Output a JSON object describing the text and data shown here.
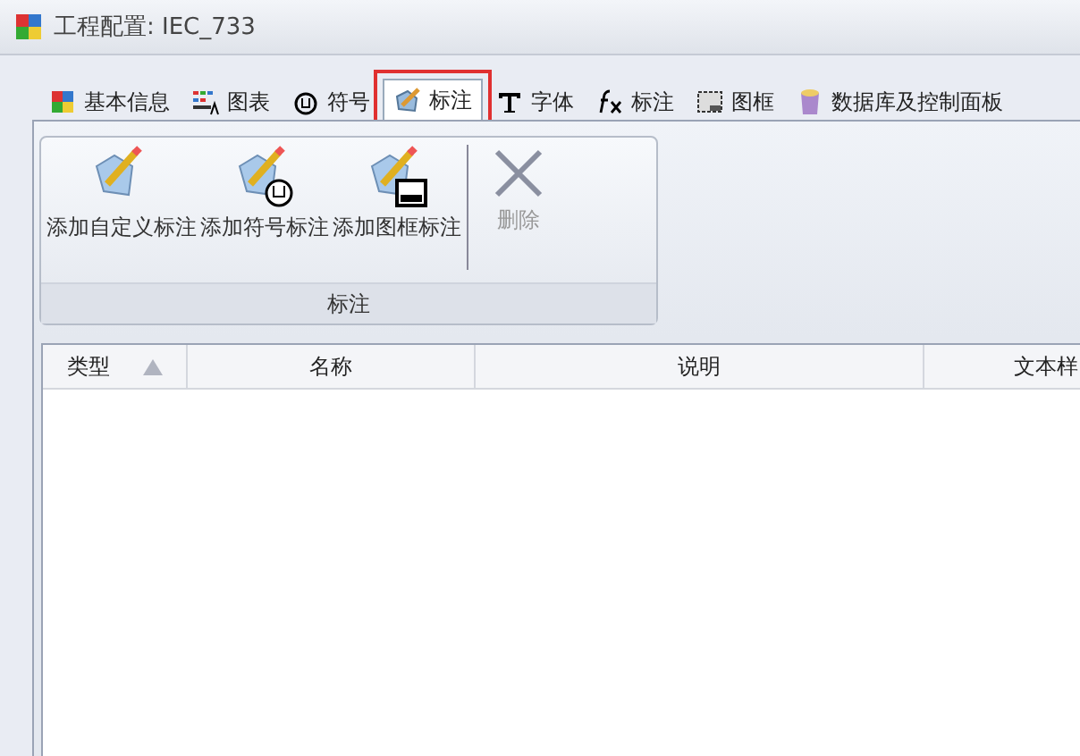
{
  "window": {
    "title": "工程配置: IEC_733"
  },
  "tabs": [
    {
      "label": "基本信息",
      "selected": false
    },
    {
      "label": "图表",
      "selected": false
    },
    {
      "label": "符号",
      "selected": false
    },
    {
      "label": "标注",
      "selected": true
    },
    {
      "label": "字体",
      "selected": false
    },
    {
      "label": "标注",
      "selected": false
    },
    {
      "label": "图框",
      "selected": false
    },
    {
      "label": "数据库及控制面板",
      "selected": false
    }
  ],
  "ribbon": {
    "group_label": "标注",
    "buttons": [
      {
        "label": "添加自定义标注",
        "kind": "tag",
        "disabled": false
      },
      {
        "label": "添加符号标注",
        "kind": "symbol",
        "disabled": false
      },
      {
        "label": "添加图框标注",
        "kind": "frame",
        "disabled": false
      },
      {
        "label": "删除",
        "kind": "delete",
        "disabled": true
      }
    ]
  },
  "table": {
    "columns": [
      {
        "label": "类型",
        "sorted": true
      },
      {
        "label": "名称",
        "sorted": false
      },
      {
        "label": "说明",
        "sorted": false
      },
      {
        "label": "文本样",
        "sorted": false
      }
    ]
  }
}
